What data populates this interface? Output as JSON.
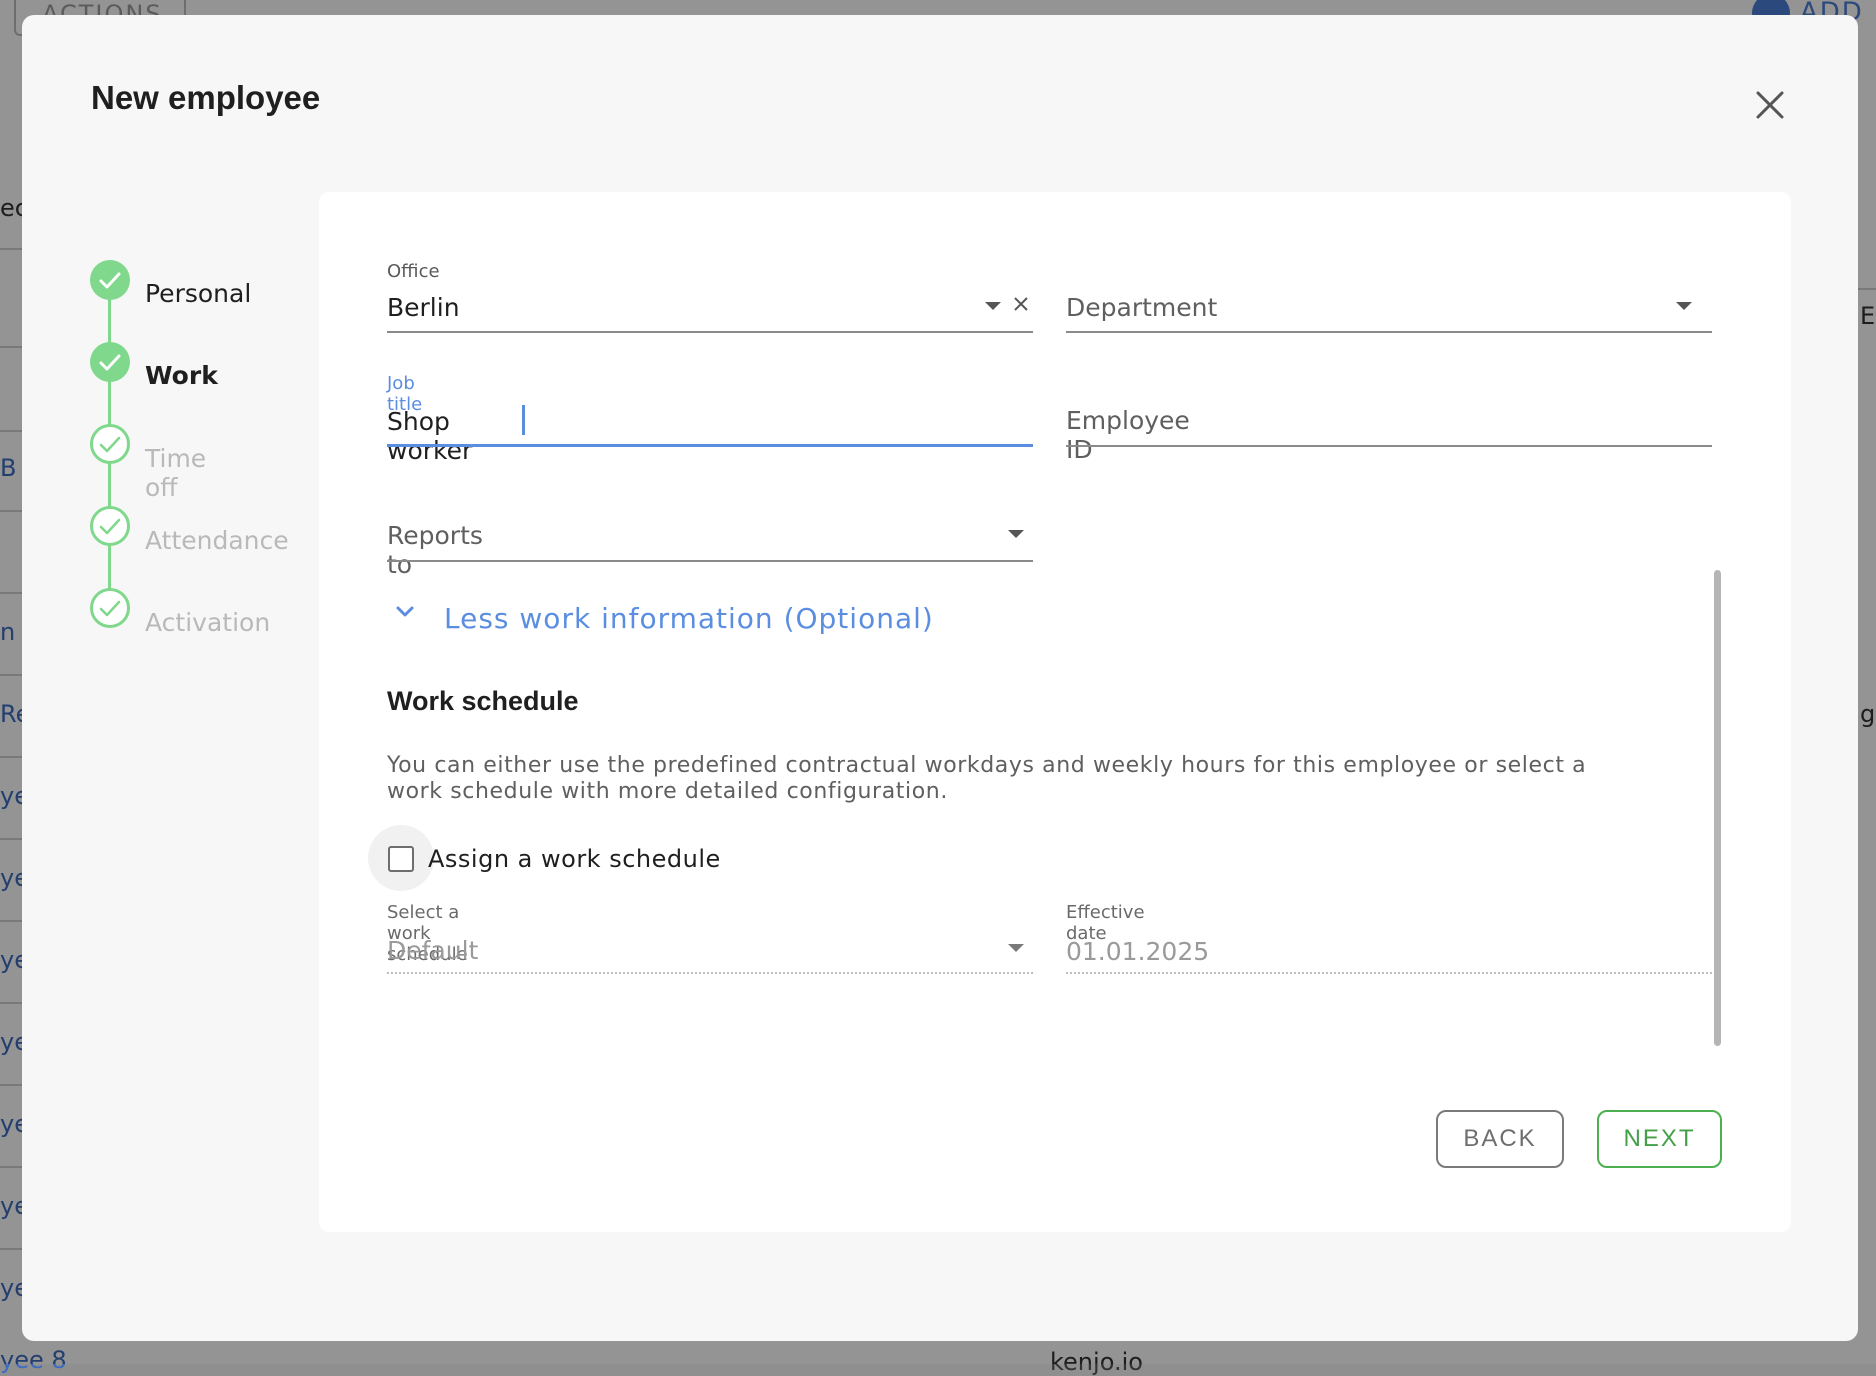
{
  "background": {
    "actions_label": "ACTIONS",
    "add_label": "ADD",
    "left_fragments": [
      "ec",
      "B",
      "n",
      "Re",
      "ye",
      "ye",
      "ye",
      "ye",
      "ye",
      "ye",
      "ye",
      "yee 8"
    ],
    "right_fragments": [
      "EI",
      "g"
    ],
    "bottom_fragment": "kenjo.io"
  },
  "dialog": {
    "title": "New employee",
    "close_icon": "close-icon"
  },
  "stepper": {
    "steps": [
      {
        "label": "Personal",
        "state": "done"
      },
      {
        "label": "Work",
        "state": "active"
      },
      {
        "label": "Time off",
        "state": "todo"
      },
      {
        "label": "Attendance",
        "state": "todo"
      },
      {
        "label": "Activation",
        "state": "todo"
      }
    ],
    "accent_color": "#7fd88b"
  },
  "form": {
    "office": {
      "label": "Office",
      "value": "Berlin"
    },
    "department": {
      "placeholder": "Department"
    },
    "job_title": {
      "label": "Job title",
      "value": "Shop worker"
    },
    "employee_id": {
      "placeholder": "Employee ID"
    },
    "reports_to": {
      "placeholder": "Reports to"
    },
    "toggle_link": "Less work information (Optional)"
  },
  "work_schedule": {
    "title": "Work schedule",
    "description": "You can either use the predefined contractual workdays and weekly hours for this employee or select a work schedule with more detailed configuration.",
    "checkbox_label": "Assign a work schedule",
    "checkbox_checked": false,
    "select_label": "Select a work schedule",
    "select_value": "Default",
    "date_label": "Effective date",
    "date_value": "01.01.2025"
  },
  "actions": {
    "back_label": "BACK",
    "next_label": "NEXT"
  },
  "colors": {
    "focus_blue": "#5b8ee0",
    "success_green": "#43a047"
  }
}
